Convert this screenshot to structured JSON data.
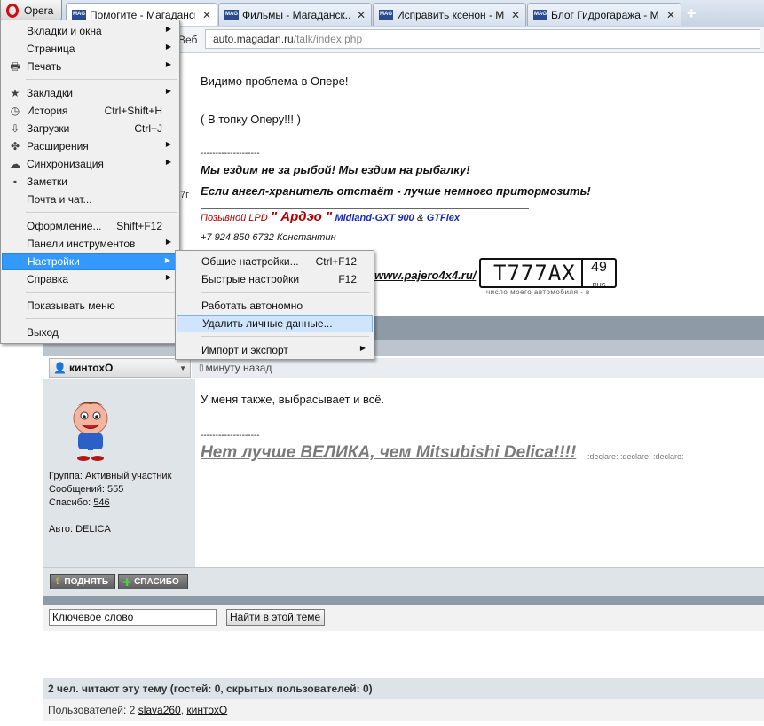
{
  "browser": {
    "menu_button": "Opera",
    "tabs": [
      {
        "title": "Помогите - Магаданск..."
      },
      {
        "title": "Фильмы - Магаданск..."
      },
      {
        "title": "Исправить ксенон - М..."
      },
      {
        "title": "Блог Гидрогаража - М..."
      }
    ],
    "new_tab": "+",
    "web_label": "Веб",
    "url_host": "auto.magadan.ru",
    "url_path": "/talk/index.php"
  },
  "main_menu": {
    "items": [
      {
        "label": "Вкладки и окна"
      },
      {
        "label": "Страница"
      },
      {
        "label": "Печать"
      },
      {
        "label": "Закладки"
      },
      {
        "label": "История",
        "shortcut": "Ctrl+Shift+H"
      },
      {
        "label": "Загрузки",
        "shortcut": "Ctrl+J"
      },
      {
        "label": "Расширения"
      },
      {
        "label": "Синхронизация"
      },
      {
        "label": "Заметки"
      },
      {
        "label": "Почта и чат..."
      },
      {
        "label": "Оформление...",
        "shortcut": "Shift+F12"
      },
      {
        "label": "Панели инструментов"
      },
      {
        "label": "Настройки"
      },
      {
        "label": "Справка"
      },
      {
        "label": "Показывать меню"
      },
      {
        "label": "Выход"
      }
    ]
  },
  "settings_submenu": {
    "items": [
      {
        "label": "Общие настройки...",
        "shortcut": "Ctrl+F12"
      },
      {
        "label": "Быстрые настройки",
        "shortcut": "F12"
      },
      {
        "label": "Работать автономно"
      },
      {
        "label": "Удалить личные данные..."
      },
      {
        "label": "Импорт и экспорт"
      }
    ]
  },
  "post1": {
    "line1": "Видимо проблема в Опере!",
    "line2": "( В топку Оперу!!! )",
    "sig_dashes": "--------------------",
    "sig1": "Мы ездим не за рыбой! Мы ездим на рыбалку!",
    "sig2": "Если ангел-хранитель отстаёт - лучше немного притормозить!",
    "callsign_prefix": "Позывной LPD",
    "callsign_name": "\" Ардэо \"",
    "radio1": "Midland-GXT 900",
    "amp": "&",
    "radio2": "GTFlex",
    "phone": "+7 924 850 6732 Константин",
    "site": "www.pajero4x4.ru/",
    "partial_text": "7г",
    "plate_number": "Т777АХ",
    "plate_region": "49",
    "plate_rus": "RUS",
    "plate_caption": "число моего автомобиля - в"
  },
  "post2": {
    "author": "кинтохО",
    "time": "минуту назад",
    "group": "Группа: Активный участник",
    "messages": "Сообщений: 555",
    "thanks_label": "Спасибо:",
    "thanks_count": "546",
    "auto": "Авто: DELICA",
    "text": "У меня также, выбрасывает и всё.",
    "sig_dashes": "--------------------",
    "sig": "Нет лучше ВЕЛИКА, чем Mitsubishi Delica!!!!",
    "smileys": ":declare: :declare: :declare:",
    "btn_up": "ПОДНЯТЬ",
    "btn_thanks": "СПАСИБО"
  },
  "search": {
    "keyword_value": "Ключевое слово",
    "button": "Найти в этой теме"
  },
  "footer": {
    "readers": "2 чел. читают эту тему (гостей: 0, скрытых пользователей: 0)",
    "users_prefix": "Пользователей: 2",
    "user1": "slava260",
    "comma": ",",
    "user2": "кинтохО"
  }
}
